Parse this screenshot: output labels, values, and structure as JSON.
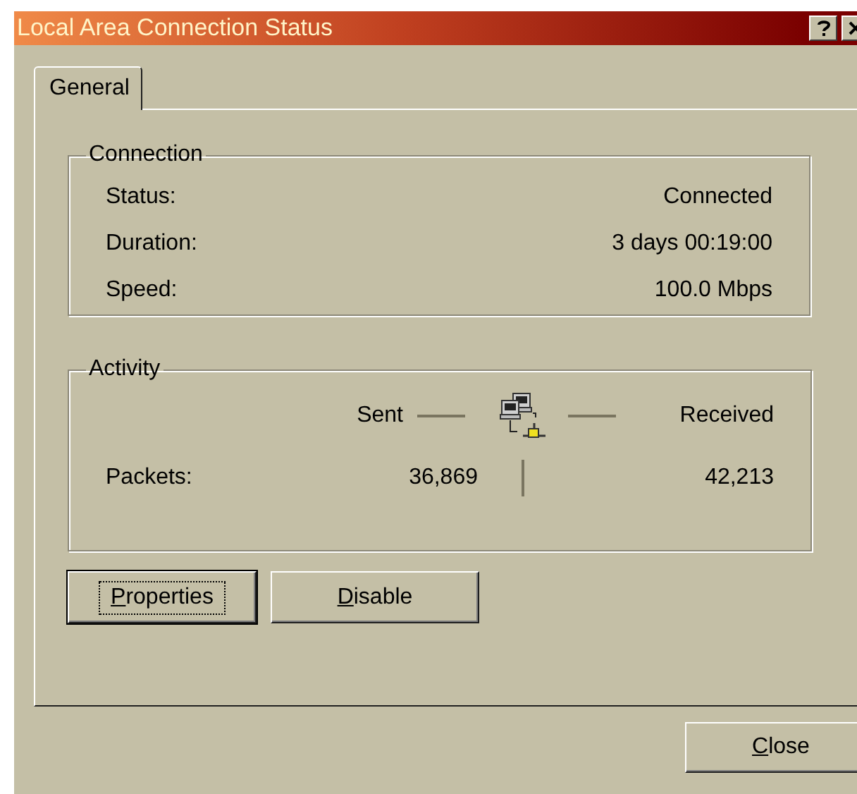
{
  "window": {
    "title": "Local Area Connection Status"
  },
  "tabs": [
    {
      "label": "General",
      "selected": true
    }
  ],
  "connection": {
    "legend": "Connection",
    "rows": [
      {
        "label": "Status:",
        "value": "Connected"
      },
      {
        "label": "Duration:",
        "value": "3 days 00:19:00"
      },
      {
        "label": "Speed:",
        "value": "100.0 Mbps"
      }
    ]
  },
  "activity": {
    "legend": "Activity",
    "sent_label": "Sent",
    "received_label": "Received",
    "packets_label": "Packets:",
    "packets_sent": "36,869",
    "packets_received": "42,213"
  },
  "buttons": [
    {
      "accel": "P",
      "rest": "roperties",
      "focused": true
    },
    {
      "accel": "D",
      "rest": "isable",
      "focused": false
    }
  ],
  "close_button": {
    "accel": "C",
    "rest": "lose"
  }
}
